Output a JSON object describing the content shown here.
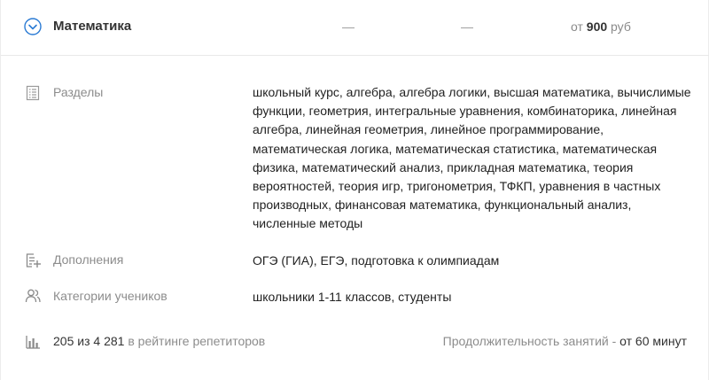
{
  "header": {
    "subject": "Математика",
    "col1": "—",
    "col2": "—",
    "price_prefix": "от",
    "price_value": "900",
    "price_unit": "руб"
  },
  "rows": [
    {
      "icon": "document-list-icon",
      "label": "Разделы",
      "value": "школьный курс, алгебра, алгебра логики, высшая математика, вычислимые функции, геометрия, интегральные уравнения, комбинаторика, линейная алгебра, линейная геометрия, линейное программирование, математическая логика, математическая статистика, математическая физика, математический анализ, прикладная математика, теория вероятностей, теория игр, тригонометрия, ТФКП, уравнения в частных производных, финансовая математика, функциональный анализ, численные методы"
    },
    {
      "icon": "list-add-icon",
      "label": "Дополнения",
      "value": "ОГЭ (ГИА), ЕГЭ, подготовка к олимпиадам"
    },
    {
      "icon": "users-icon",
      "label": "Категории учеников",
      "value": "школьники 1-11 классов, студенты"
    }
  ],
  "footer": {
    "rating_icon": "bar-chart-icon",
    "rank": "205",
    "of": "из",
    "total": "4 281",
    "rating_text": "в рейтинге репетиторов",
    "duration_label": "Продолжительность занятий -",
    "duration_value": "от 60 минут"
  }
}
